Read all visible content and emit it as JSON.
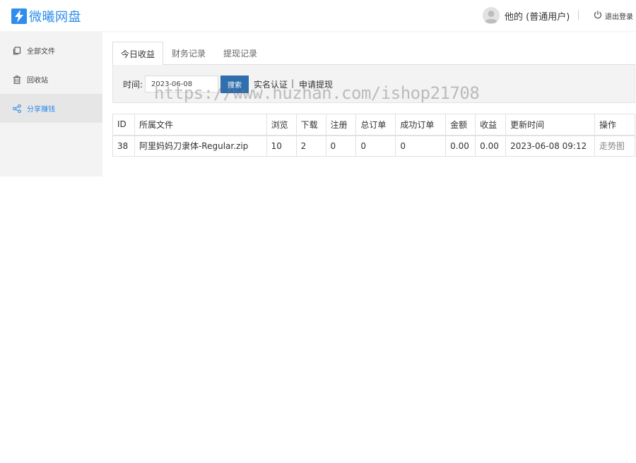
{
  "header": {
    "logo_text": "微曦网盘",
    "user_name": "他的 (普通用户)",
    "logout_label": "退出登录"
  },
  "sidebar": {
    "items": [
      {
        "label": "全部文件",
        "icon": "copy-icon"
      },
      {
        "label": "回收站",
        "icon": "trash-icon"
      },
      {
        "label": "分享赚钱",
        "icon": "share-icon"
      }
    ],
    "active_index": 2
  },
  "tabs": [
    {
      "label": "今日收益"
    },
    {
      "label": "财务记录"
    },
    {
      "label": "提现记录"
    }
  ],
  "filter": {
    "time_label": "时间:",
    "date_value": "2023-06-08",
    "search_label": "搜索",
    "verify_label": "实名认证",
    "separator": "|",
    "withdraw_label": "申请提现"
  },
  "watermark": "https://www.huzhan.com/ishop21708",
  "table": {
    "headers": [
      "ID",
      "所属文件",
      "浏览",
      "下载",
      "注册",
      "总订单",
      "成功订单",
      "金额",
      "收益",
      "更新时间",
      "操作"
    ],
    "rows": [
      [
        "38",
        "阿里妈妈刀隶体-Regular.zip",
        "10",
        "2",
        "0",
        "0",
        "0",
        "0.00",
        "0.00",
        "2023-06-08 09:12",
        "走势图"
      ]
    ]
  },
  "colors": {
    "brand": "#2f8ded",
    "button": "#2f6fae"
  }
}
